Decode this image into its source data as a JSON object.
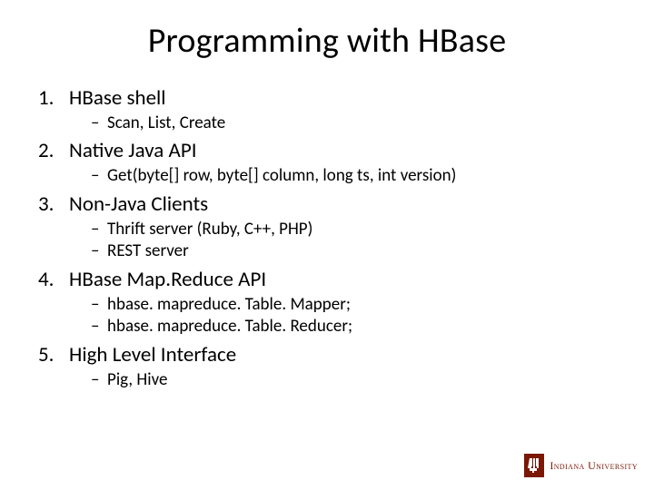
{
  "title": "Programming with HBase",
  "items": [
    {
      "heading": "HBase shell",
      "subs": [
        "Scan, List, Create"
      ]
    },
    {
      "heading": "Native Java API",
      "subs": [
        "Get(byte[] row, byte[] column, long ts, int version)"
      ]
    },
    {
      "heading": "Non-Java Clients",
      "subs": [
        "Thrift server (Ruby, C++, PHP)",
        "REST server"
      ]
    },
    {
      "heading": "HBase Map.Reduce API",
      "subs": [
        "hbase. mapreduce. Table. Mapper;",
        "hbase. mapreduce. Table. Reducer;"
      ]
    },
    {
      "heading": "High Level Interface",
      "subs": [
        "Pig, Hive"
      ]
    }
  ],
  "footer": {
    "university": "Indiana University"
  }
}
